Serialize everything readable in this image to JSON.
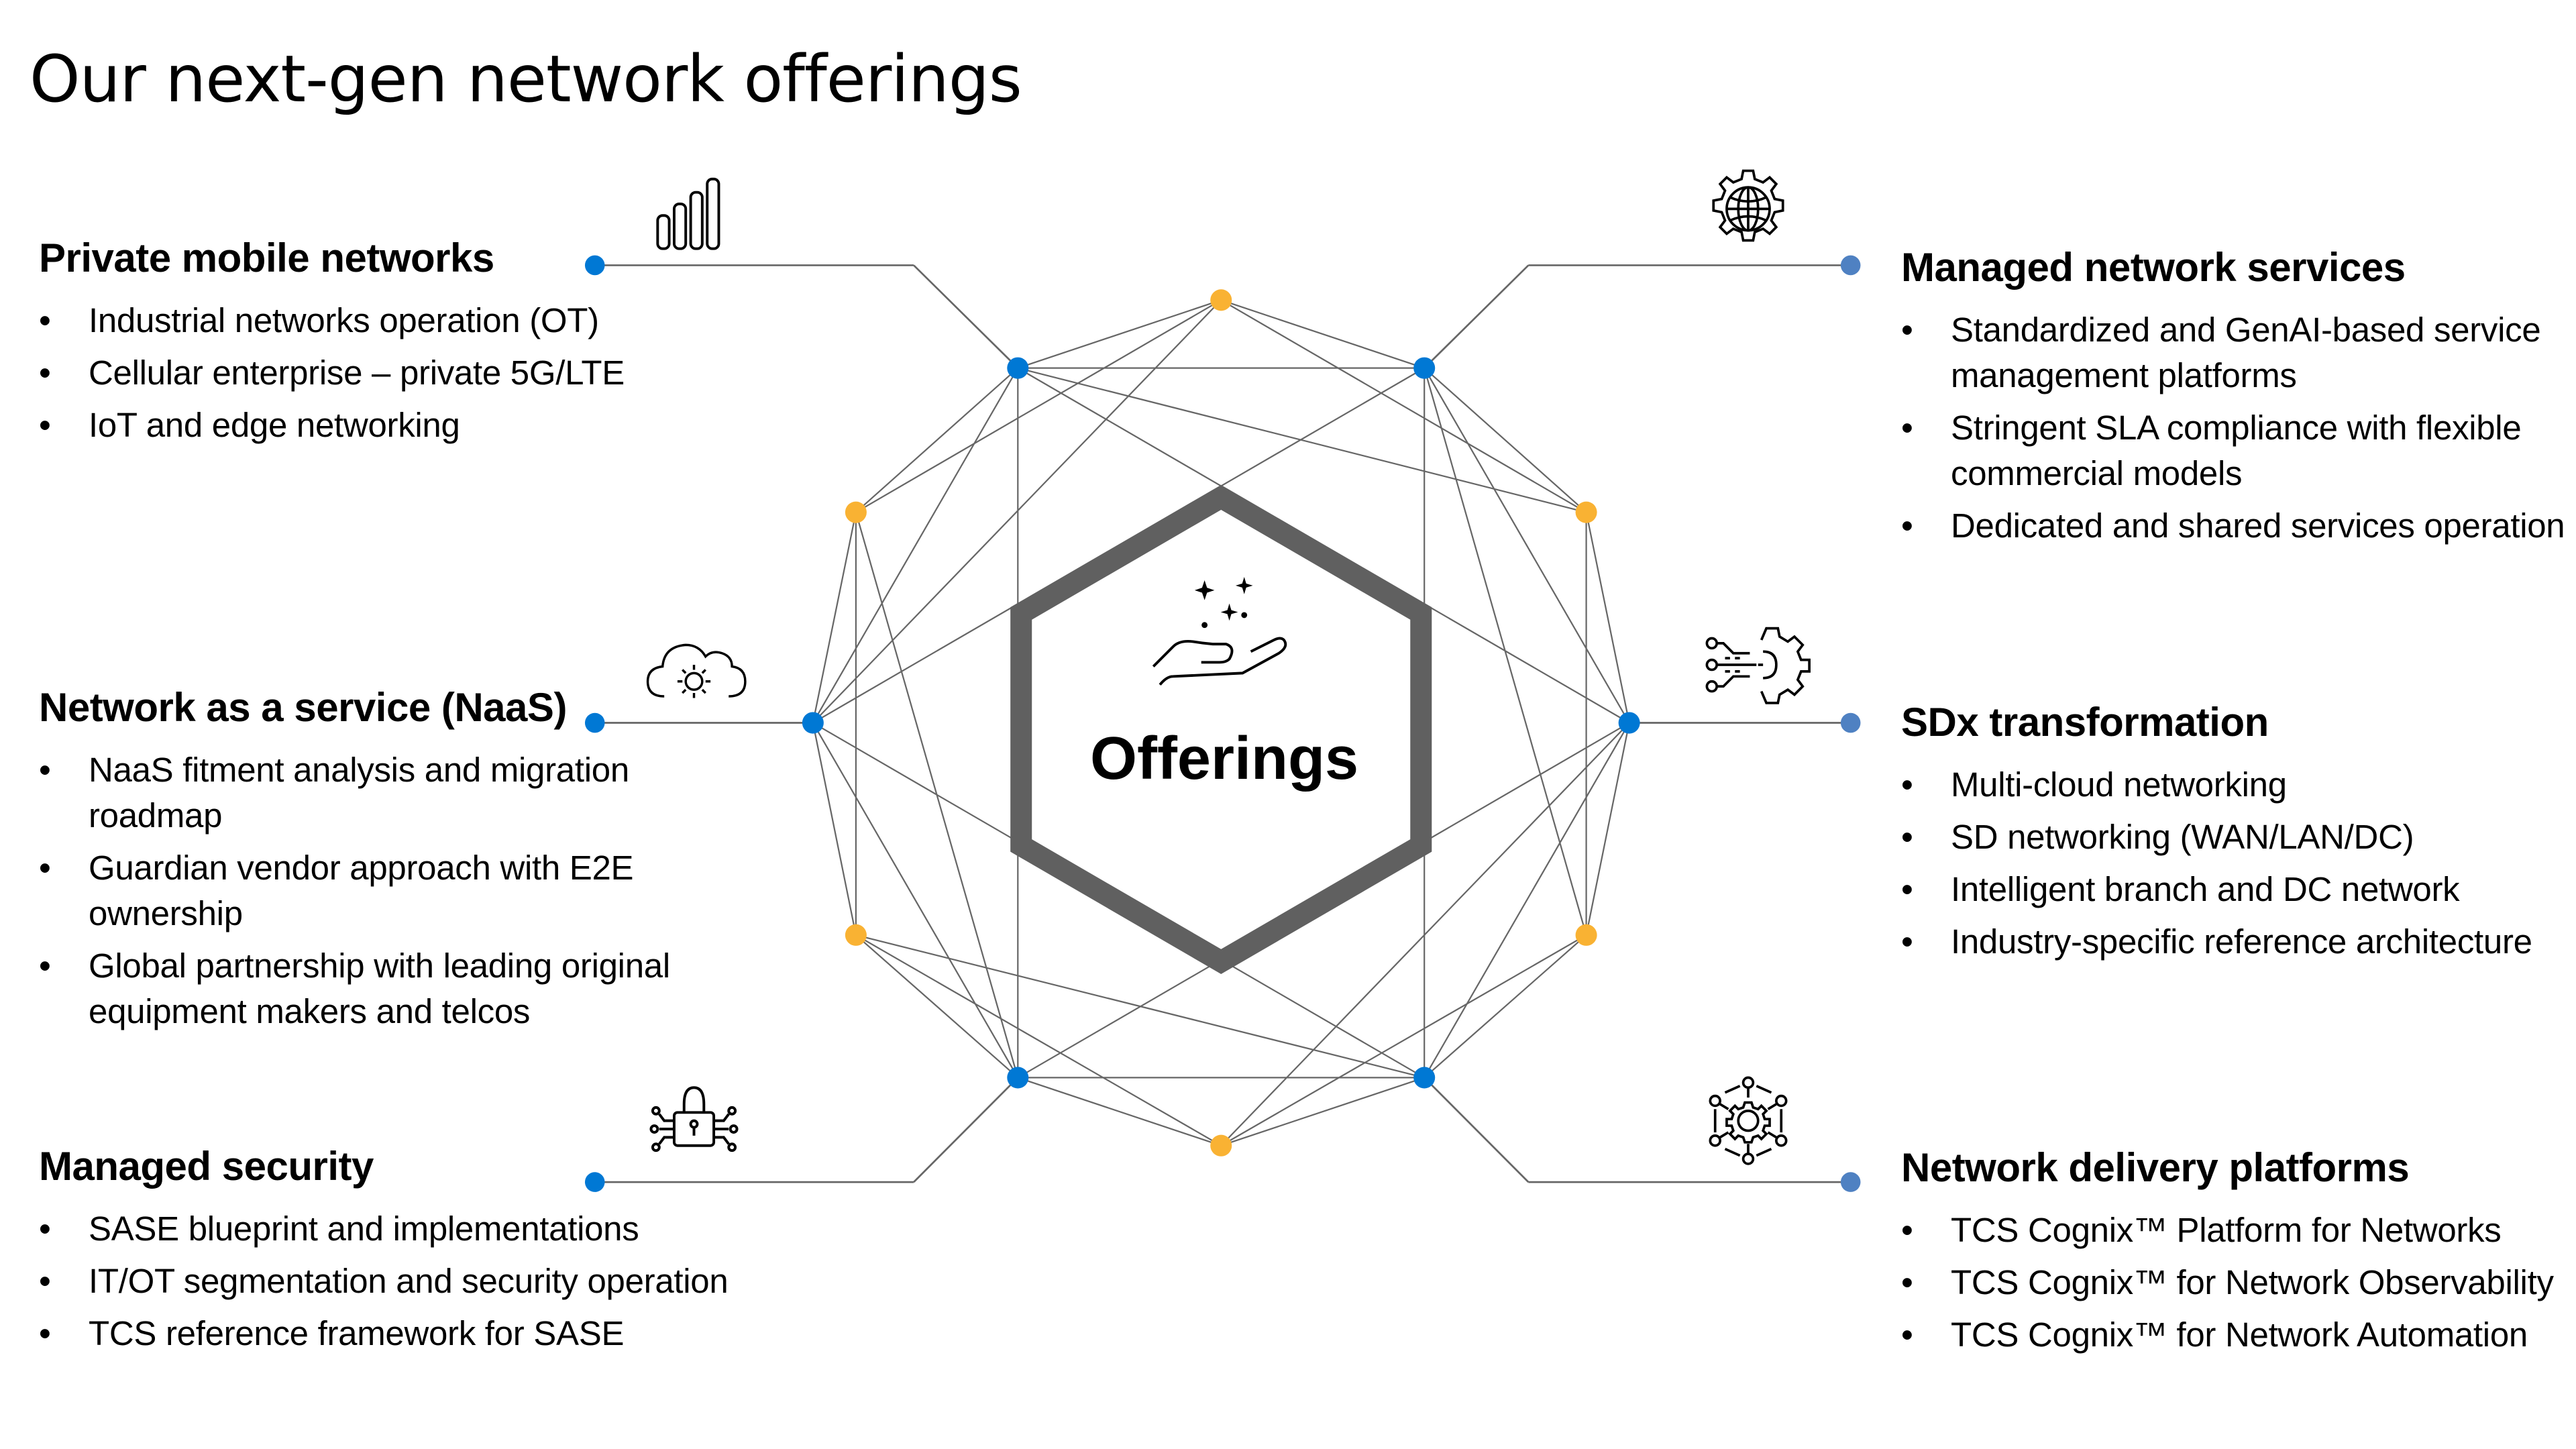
{
  "title": "Our next-gen network offerings",
  "center": {
    "label": "Offerings",
    "icon": "hand-sparkles-icon"
  },
  "colors": {
    "inner_blue": "#0078D4",
    "outer_blue": "#4F81C2",
    "orange": "#F9B233",
    "line": "#666666",
    "hexagon": "#606060"
  },
  "offerings": {
    "private_mobile": {
      "heading": "Private mobile networks",
      "icon": "signal-bars-icon",
      "bullets": [
        "Industrial networks operation (OT)",
        "Cellular enterprise – private 5G/LTE",
        "IoT and edge networking"
      ]
    },
    "naas": {
      "heading": "Network as a service (NaaS)",
      "icon": "cloud-gear-icon",
      "bullets": [
        "NaaS fitment analysis and migration roadmap",
        "Guardian vendor approach with E2E ownership",
        "Global partnership with leading original equipment makers and telcos"
      ]
    },
    "security": {
      "heading": "Managed security",
      "icon": "circuit-lock-icon",
      "bullets": [
        "SASE blueprint and implementations",
        "IT/OT segmentation and security operation",
        "TCS reference framework for SASE"
      ]
    },
    "managed_services": {
      "heading": "Managed network services",
      "icon": "globe-gear-icon",
      "bullets": [
        "Standardized and GenAI-based service management platforms",
        "Stringent SLA compliance with flexible commercial models",
        "Dedicated and shared services operation"
      ]
    },
    "sdx": {
      "heading": "SDx transformation",
      "icon": "circuit-gear-icon",
      "bullets": [
        "Multi-cloud networking",
        "SD networking (WAN/LAN/DC)",
        "Intelligent branch and DC network",
        "Industry-specific reference architecture"
      ]
    },
    "delivery": {
      "heading": "Network delivery platforms",
      "icon": "network-gear-icon",
      "bullets": [
        "TCS Cognix™ Platform for Networks",
        "TCS Cognix™ for Network Observability",
        "TCS Cognix™ for Network Automation"
      ]
    }
  }
}
